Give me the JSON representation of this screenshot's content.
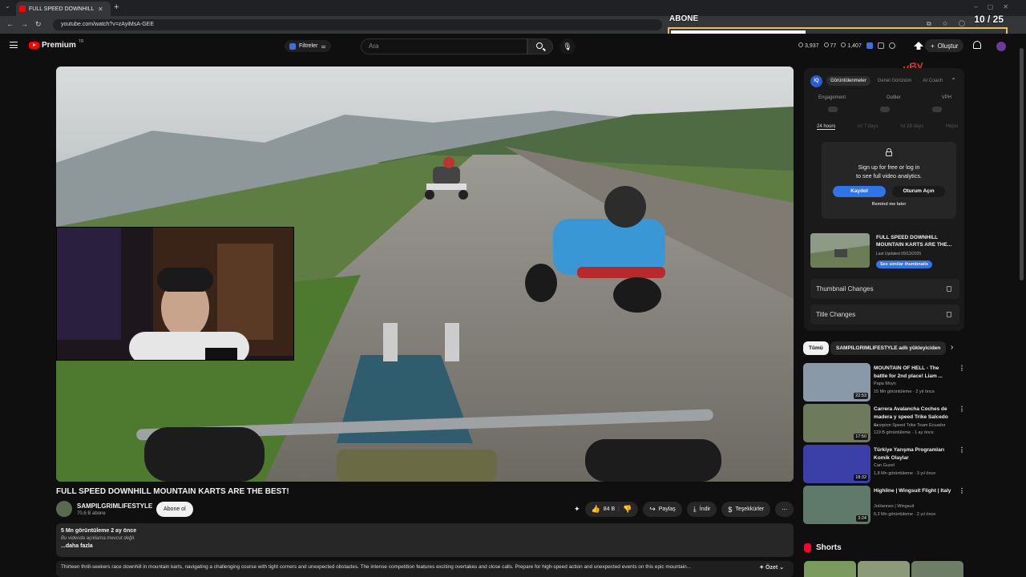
{
  "browser": {
    "tab_title": "FULL SPEED DOWNHILL M",
    "new_tab": "+",
    "url": "youtube.com/watch?v=zAyiMsA-GEE"
  },
  "overlay": {
    "sub_label": "ABONE",
    "sub_count": "10 / 25",
    "sub_progress": 0.4
  },
  "header": {
    "brand": "Premium",
    "region": "TR",
    "filter_label": "Filtreler",
    "search_placeholder": "Ara",
    "stats": [
      "3,937",
      "77",
      "1,407"
    ],
    "create_label": "Oluştur"
  },
  "video": {
    "title": "FULL SPEED DOWNHILL MOUNTAIN KARTS ARE THE BEST!",
    "channel": "SAMPILGRIMLIFESTYLE",
    "subs": "70,6 B abone",
    "subscribe_label": "Abone ol",
    "likes": "84 B",
    "share_label": "Paylaş",
    "download_label": "İndir",
    "thanks_label": "Teşekkürler",
    "views_date": "5 Mn görüntüleme  2 ay önce",
    "no_desc": "Bu videoda açıklama mevcut değil.",
    "more_label": "...daha fazla",
    "summary": "Thirteen thrill-seekers race downhill in mountain karts, navigating a challenging course with tight corners and unexpected obstacles. The intense competition features exciting overtakes and close calls. Prepare for high-speed action and unexpected events on this epic mountain...",
    "summary_btn": "Özet"
  },
  "panel": {
    "logo": "IQ",
    "tabs": [
      "Görüntülenmeler",
      "Genel Görünüm",
      "AI Coach"
    ],
    "metrics": [
      "Engagement",
      "Outlier",
      "VPH"
    ],
    "time_ranges": [
      "24 hours",
      "Ist 7 days",
      "Ist 28 days",
      "Hepsi"
    ],
    "lock_title_1": "Sign up for free or log in",
    "lock_title_2": "to see full video analytics.",
    "signup_label": "Kaydol",
    "login_label": "Oturum Açın",
    "remind_label": "Remind me later",
    "preview_title": "FULL SPEED DOWNHILL MOUNTAIN KARTS ARE THE...",
    "preview_date": "Last Updated 09/13/2025",
    "preview_btn": "See similar thumbnails",
    "thumb_changes": "Thumbnail Changes",
    "title_changes": "Title Changes"
  },
  "chips": {
    "all": "Tümü",
    "uploader": "SAMPILGRIMLIFESTYLE adlı yükleyiciden"
  },
  "recommendations": [
    {
      "title": "MOUNTAIN OF HELL - The battle for 2nd place! Liam ...",
      "channel": "Papa Moyn",
      "meta": "15 Mn görüntüleme  ·  2 yıl önce",
      "duration": "22:53",
      "color": "#8a99a8"
    },
    {
      "title": "Carrera Avalancha Coches de madera y speed Trike Salcedo ...",
      "channel": "Scorpion Speed Trike Team Ecuador",
      "meta": "119 B görüntüleme  ·  1 ay önce",
      "duration": "17:50",
      "color": "#6d7a5c"
    },
    {
      "title": "Türkiye Yarışma Programları Komik Olaylar",
      "channel": "Can Guzel",
      "meta": "1,8 Mn görüntüleme  ·  3 yıl önce",
      "duration": "18:32",
      "color": "#3b3fa8"
    },
    {
      "title": "Highline | Wingsuit Flight | Italy",
      "channel": "JoHannes | Wingsuit",
      "meta": "6,2 Mn görüntüleme  ·  2 yıl önce",
      "duration": "3:24",
      "color": "#5f7a6a"
    }
  ],
  "shorts": {
    "label": "Shorts"
  },
  "watermark": "yBy"
}
